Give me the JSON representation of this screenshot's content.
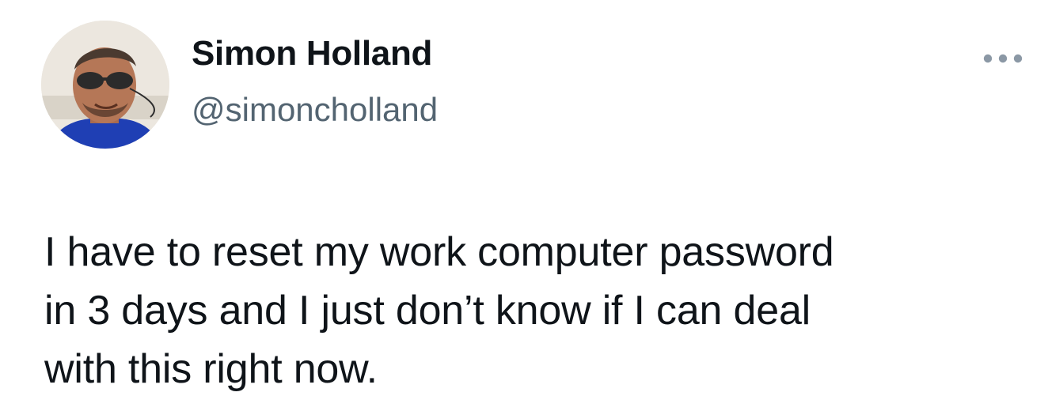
{
  "tweet": {
    "author": {
      "name": "Simon Holland",
      "handle": "@simoncholland",
      "avatar_icon": "profile-photo-avatar"
    },
    "more_icon": "more-horizontal-icon",
    "text": "I have to reset my work computer password\nin 3 days and I just don’t know if I can deal\nwith this right now."
  },
  "colors": {
    "text_primary": "#0f1419",
    "text_secondary": "#536471",
    "icon_muted": "#8b98a5",
    "background": "#ffffff"
  }
}
